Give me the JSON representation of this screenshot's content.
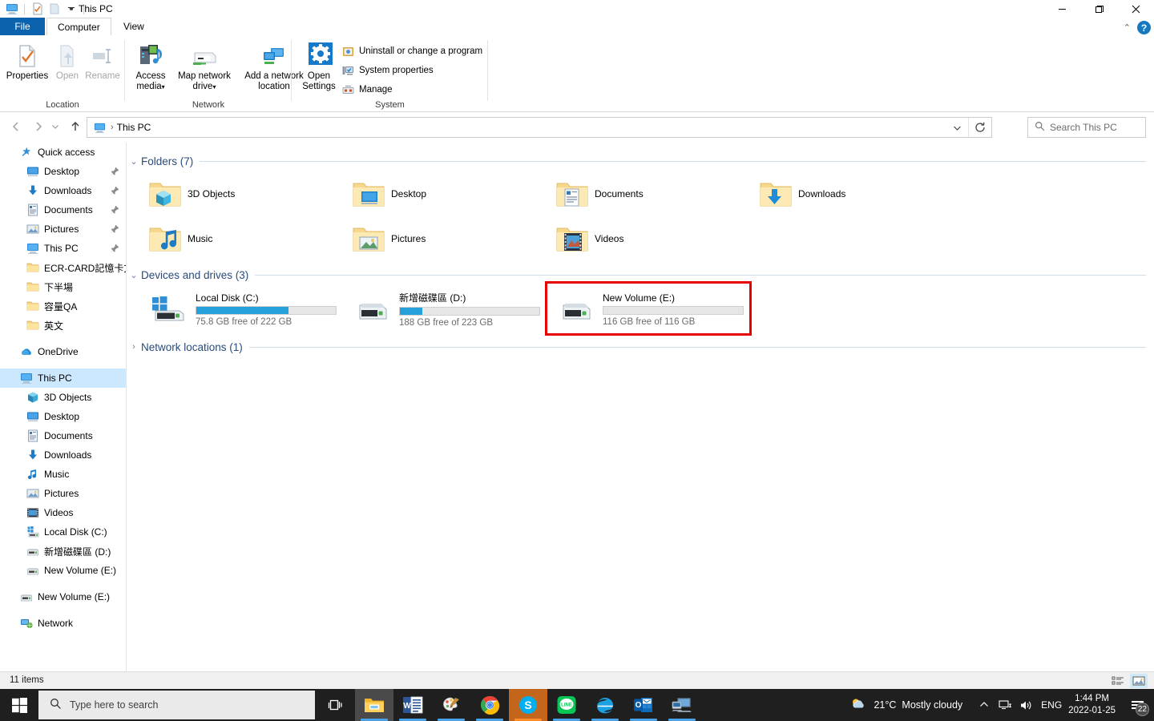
{
  "window": {
    "title": "This PC",
    "quick_access_icons": [
      "this-pc-icon",
      "properties-icon",
      "new-folder-icon"
    ],
    "dropdown_caret": "▾",
    "minimize": "—",
    "maximize": "❐",
    "close": "✕"
  },
  "ribbon": {
    "tabs": [
      {
        "label": "File",
        "active": false,
        "style": "file"
      },
      {
        "label": "Computer",
        "active": true,
        "style": "normal"
      },
      {
        "label": "View",
        "active": false,
        "style": "normal"
      }
    ],
    "collapse_caret": "⌃",
    "help_label": "?",
    "groups": [
      {
        "name": "Location",
        "buttons": [
          {
            "label_line1": "Properties",
            "label_line2": "",
            "icon": "properties-icon",
            "disabled": false
          },
          {
            "label_line1": "Open",
            "label_line2": "",
            "icon": "open-icon",
            "disabled": true
          },
          {
            "label_line1": "Rename",
            "label_line2": "",
            "icon": "rename-icon",
            "disabled": true
          }
        ]
      },
      {
        "name": "Network",
        "buttons": [
          {
            "label_line1": "Access",
            "label_line2": "media",
            "icon": "access-media-icon",
            "disabled": false,
            "caret": "▾"
          },
          {
            "label_line1": "Map network",
            "label_line2": "drive",
            "icon": "map-network-drive-icon",
            "disabled": false,
            "caret": "▾"
          },
          {
            "label_line1": "Add a network",
            "label_line2": "location",
            "icon": "add-network-location-icon",
            "disabled": false
          }
        ]
      },
      {
        "name": "System",
        "buttons": [
          {
            "label_line1": "Open",
            "label_line2": "Settings",
            "icon": "open-settings-icon",
            "disabled": false
          }
        ],
        "small_items": [
          {
            "label": "Uninstall or change a program",
            "icon": "uninstall-program-icon"
          },
          {
            "label": "System properties",
            "icon": "system-properties-icon"
          },
          {
            "label": "Manage",
            "icon": "manage-icon"
          }
        ]
      }
    ]
  },
  "address_bar": {
    "back": "←",
    "forward": "→",
    "recent": "⌄",
    "up": "↑",
    "crumb_icon": "this-pc-icon",
    "crumb_separator": "›",
    "path": "This PC",
    "dropdown": "⌄",
    "refresh": "↻"
  },
  "search": {
    "placeholder": "Search This PC",
    "icon": "search-icon"
  },
  "sidebar": {
    "items": [
      {
        "label": "Quick access",
        "icon": "star-pin-icon",
        "indent": 0,
        "pinned": false,
        "selected": false
      },
      {
        "label": "Desktop",
        "icon": "desktop-icon",
        "indent": 1,
        "pinned": true,
        "selected": false
      },
      {
        "label": "Downloads",
        "icon": "downloads-icon",
        "indent": 1,
        "pinned": true,
        "selected": false
      },
      {
        "label": "Documents",
        "icon": "documents-icon",
        "indent": 1,
        "pinned": true,
        "selected": false
      },
      {
        "label": "Pictures",
        "icon": "pictures-icon",
        "indent": 1,
        "pinned": true,
        "selected": false
      },
      {
        "label": "This PC",
        "icon": "this-pc-icon",
        "indent": 1,
        "pinned": true,
        "selected": false
      },
      {
        "label": "ECR-CARD記憶卡文",
        "icon": "folder-icon",
        "indent": 1,
        "pinned": false,
        "selected": false
      },
      {
        "label": "下半場",
        "icon": "folder-icon",
        "indent": 1,
        "pinned": false,
        "selected": false
      },
      {
        "label": "容量QA",
        "icon": "folder-icon",
        "indent": 1,
        "pinned": false,
        "selected": false
      },
      {
        "label": "英文",
        "icon": "folder-icon",
        "indent": 1,
        "pinned": false,
        "selected": false
      },
      {
        "label": "OneDrive",
        "icon": "onedrive-icon",
        "indent": 0,
        "pinned": false,
        "selected": false,
        "spacer_before": true
      },
      {
        "label": "This PC",
        "icon": "this-pc-icon",
        "indent": 0,
        "pinned": false,
        "selected": true,
        "spacer_before": true
      },
      {
        "label": "3D Objects",
        "icon": "3d-objects-icon",
        "indent": 1,
        "pinned": false,
        "selected": false
      },
      {
        "label": "Desktop",
        "icon": "desktop-icon",
        "indent": 1,
        "pinned": false,
        "selected": false
      },
      {
        "label": "Documents",
        "icon": "documents-icon",
        "indent": 1,
        "pinned": false,
        "selected": false
      },
      {
        "label": "Downloads",
        "icon": "downloads-icon",
        "indent": 1,
        "pinned": false,
        "selected": false
      },
      {
        "label": "Music",
        "icon": "music-icon",
        "indent": 1,
        "pinned": false,
        "selected": false
      },
      {
        "label": "Pictures",
        "icon": "pictures-icon",
        "indent": 1,
        "pinned": false,
        "selected": false
      },
      {
        "label": "Videos",
        "icon": "videos-icon",
        "indent": 1,
        "pinned": false,
        "selected": false
      },
      {
        "label": "Local Disk (C:)",
        "icon": "windows-drive-icon",
        "indent": 1,
        "pinned": false,
        "selected": false
      },
      {
        "label": "新增磁碟區 (D:)",
        "icon": "drive-icon",
        "indent": 1,
        "pinned": false,
        "selected": false
      },
      {
        "label": "New Volume (E:)",
        "icon": "drive-icon",
        "indent": 1,
        "pinned": false,
        "selected": false
      },
      {
        "label": "New Volume (E:)",
        "icon": "drive-icon",
        "indent": 0,
        "pinned": false,
        "selected": false,
        "spacer_before": true
      },
      {
        "label": "Network",
        "icon": "network-icon",
        "indent": 0,
        "pinned": false,
        "selected": false,
        "spacer_before": true
      }
    ]
  },
  "content": {
    "groups": [
      {
        "title": "Folders (7)",
        "expanded": true,
        "chevron": "⌄",
        "items": [
          {
            "label": "3D Objects",
            "icon": "folder-3d-objects-icon"
          },
          {
            "label": "Desktop",
            "icon": "folder-desktop-icon"
          },
          {
            "label": "Documents",
            "icon": "folder-documents-icon"
          },
          {
            "label": "Downloads",
            "icon": "folder-downloads-icon"
          },
          {
            "label": "Music",
            "icon": "folder-music-icon"
          },
          {
            "label": "Pictures",
            "icon": "folder-pictures-icon"
          },
          {
            "label": "Videos",
            "icon": "folder-videos-icon"
          }
        ]
      },
      {
        "title": "Devices and drives (3)",
        "expanded": true,
        "chevron": "⌄",
        "drives": [
          {
            "name": "Local Disk (C:)",
            "free_text": "75.8 GB free of 222 GB",
            "used_percent": 66,
            "icon": "windows-drive-icon",
            "highlighted": false
          },
          {
            "name": "新增磁碟區 (D:)",
            "free_text": "188 GB free of 223 GB",
            "used_percent": 16,
            "icon": "drive-icon",
            "highlighted": false
          },
          {
            "name": "New Volume (E:)",
            "free_text": "116 GB free of 116 GB",
            "used_percent": 0,
            "icon": "drive-icon",
            "highlighted": true
          }
        ]
      },
      {
        "title": "Network locations (1)",
        "expanded": false,
        "chevron": "›",
        "items": []
      }
    ],
    "highlight_color": "#e60000"
  },
  "status_bar": {
    "item_count": "11 items",
    "views": [
      {
        "name": "details-view",
        "active": false
      },
      {
        "name": "large-icons-view",
        "active": true
      }
    ]
  },
  "taskbar": {
    "start_icon": "windows-start-icon",
    "search_placeholder": "Type here to search",
    "search_icon": "search-icon",
    "task_view_icon": "task-view-icon",
    "apps": [
      {
        "name": "file-explorer",
        "icon": "file-explorer-icon",
        "active": true,
        "running": true
      },
      {
        "name": "word",
        "icon": "word-icon",
        "active": false,
        "running": true
      },
      {
        "name": "paint",
        "icon": "paint-icon",
        "active": false,
        "running": true
      },
      {
        "name": "chrome",
        "icon": "chrome-icon",
        "active": false,
        "running": true
      },
      {
        "name": "skype",
        "icon": "skype-icon",
        "active": false,
        "running": true,
        "attention": true
      },
      {
        "name": "line",
        "icon": "line-icon",
        "active": false,
        "running": true
      },
      {
        "name": "internet-explorer",
        "icon": "internet-explorer-icon",
        "active": false,
        "running": true
      },
      {
        "name": "outlook",
        "icon": "outlook-icon",
        "active": false,
        "running": true
      },
      {
        "name": "remote-desktop",
        "icon": "remote-desktop-icon",
        "active": false,
        "running": true
      }
    ],
    "weather": {
      "temperature": "21°C",
      "condition": "Mostly cloudy",
      "icon": "partly-cloudy-icon"
    },
    "tray": {
      "overflow_caret": "⌃",
      "network_icon": "network-tray-icon",
      "volume_icon": "volume-icon",
      "language": "ENG"
    },
    "clock": {
      "time": "1:44 PM",
      "date": "2022-01-25"
    },
    "notifications": {
      "icon": "action-center-icon",
      "count": "22"
    }
  }
}
